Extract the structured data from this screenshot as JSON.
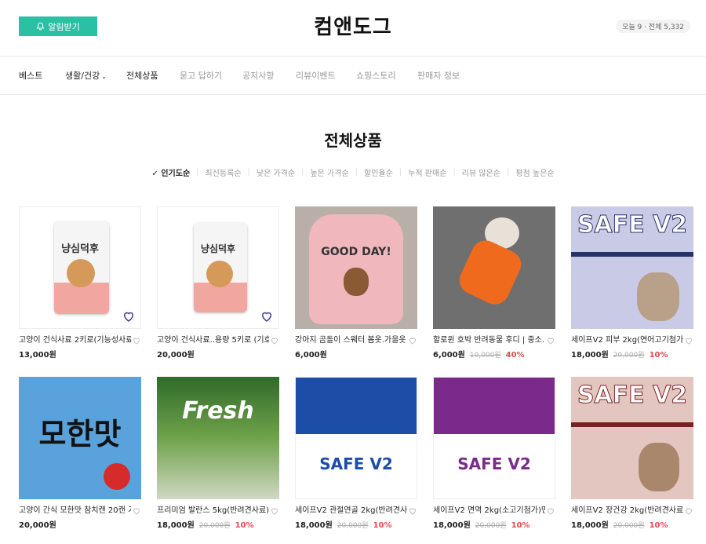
{
  "header": {
    "notify_label": "알림받기",
    "logo": "컴앤도그",
    "visitors": "오늘 9 · 전체 5,332"
  },
  "nav": {
    "items": [
      "베스트",
      "생활/건강",
      "전체상품",
      "묻고 답하기",
      "공지사항",
      "리뷰이벤트",
      "쇼핑스토리",
      "판매자 정보"
    ]
  },
  "page": {
    "title": "전체상품"
  },
  "sort": {
    "options": [
      "인기도순",
      "최신등록순",
      "낮은 가격순",
      "높은 가격순",
      "할인율순",
      "누적 판매순",
      "리뷰 많은순",
      "평점 높은순"
    ],
    "selected": "인기도순"
  },
  "products": [
    {
      "name": "고양이 건식사료 2키로(기능성사료...",
      "price": "13,000원",
      "orig": "",
      "disc": "",
      "image": "cat-food-bag",
      "thumb_text": "냥심덕후"
    },
    {
      "name": "고양이 건식사료..용량 5키로 (기호...",
      "price": "20,000원",
      "orig": "",
      "disc": "",
      "image": "cat-food-bag",
      "thumb_text": "냥심덕후"
    },
    {
      "name": "강아지 곰돌이 스웨터 봄옷.가을옷",
      "price": "6,000원",
      "orig": "",
      "disc": "",
      "image": "pink-bear-sweater",
      "thumb_text": "GOOD DAY!"
    },
    {
      "name": "할로윈 호박 반려동물 후디 | 중소...",
      "price": "6,000원",
      "orig": "10,000원",
      "disc": "40%",
      "image": "dog-pumpkin-hoodie",
      "thumb_text": ""
    },
    {
      "name": "세이프V2 피부 2kg(연어고기첨가)",
      "price": "18,000원",
      "orig": "20,000원",
      "disc": "10%",
      "image": "safe-v2-bag-blue",
      "thumb_text": "SAFE V2"
    },
    {
      "name": "고양이 간식 모한맛 참치캔 20캔 가격",
      "price": "20,000원",
      "orig": "",
      "disc": "",
      "image": "tuna-can-box",
      "thumb_text": "모한맛"
    },
    {
      "name": "프리미엄 발란스 5kg(반려견사료)...",
      "price": "18,000원",
      "orig": "20,000원",
      "disc": "10%",
      "image": "fresh-bag-green",
      "thumb_text": "Fresh"
    },
    {
      "name": "세이프V2 관절연골 2kg(반려견사...",
      "price": "18,000원",
      "orig": "20,000원",
      "disc": "10%",
      "image": "safe-v2-joint-blue",
      "thumb_text": "SAFE V2"
    },
    {
      "name": "세이프V2 면역 2kg(소고기첨가)면...",
      "price": "18,000원",
      "orig": "20,000원",
      "disc": "10%",
      "image": "safe-v2-immune-purple",
      "thumb_text": "SAFE V2"
    },
    {
      "name": "세이프V2 장건강 2kg(반려견사료) ...",
      "price": "18,000원",
      "orig": "20,000원",
      "disc": "10%",
      "image": "safe-v2-bag-red",
      "thumb_text": "SAFE V2"
    }
  ],
  "colors": {
    "accent": "#2bbfa4",
    "discount": "#e24b4b",
    "heart": "#3a3f8f"
  }
}
